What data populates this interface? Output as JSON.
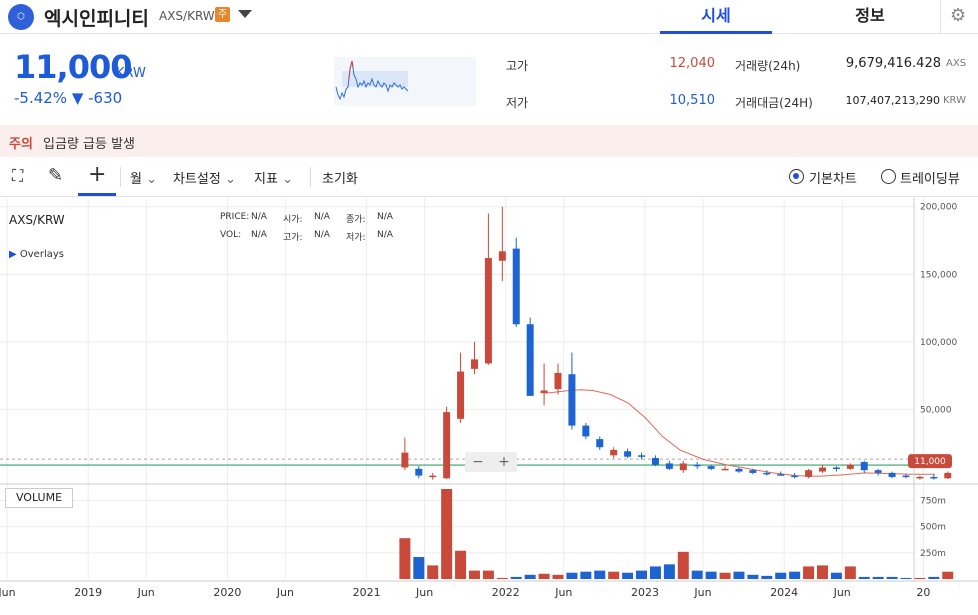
{
  "header": {
    "coin_name": "엑시인피니티",
    "pair": "AXS/KRW",
    "badge": "주",
    "tabs": [
      {
        "label": "시세",
        "active": true
      },
      {
        "label": "정보",
        "active": false
      }
    ]
  },
  "ticker": {
    "price": "11,000",
    "unit": "KRW",
    "change": "-5.42% ▼ -630",
    "high_label": "고가",
    "high": "12,040",
    "low_label": "저가",
    "low": "10,510",
    "volume_label": "거래량(24h)",
    "volume": "9,679,416.428",
    "volume_unit": "AXS",
    "amount_label": "거래대금(24H)",
    "amount": "107,407,213,290",
    "amount_unit": "KRW"
  },
  "warning": {
    "tag": "주의",
    "text": "입금량 급등 발생"
  },
  "toolbar": {
    "period": "월",
    "chart_settings": "차트설정",
    "indicators": "지표",
    "reset": "초기화",
    "basic_chart": "기본차트",
    "tradingview": "트레이딩뷰"
  },
  "colors": {
    "up": "#c94a3a",
    "down": "#1d63d1",
    "accent": "#1d4fd8",
    "ma": "#e06a5a"
  },
  "chart_data": {
    "type": "candlestick",
    "symbol": "AXS/KRW",
    "overlays_label": "Overlays",
    "ohlc_labels": {
      "price": "PRICE:",
      "vol": "VOL:",
      "open": "시가:",
      "high": "고가:",
      "close": "종가:",
      "low": "저가:",
      "na": "N/A"
    },
    "y_ticks": [
      "200,000",
      "150,000",
      "100,000",
      "50,000"
    ],
    "y_tick_values": [
      200000,
      150000,
      100000,
      50000
    ],
    "ylim": [
      -3000,
      202000
    ],
    "current_price_label": "11,000",
    "current_price": 11000,
    "x_ticks": [
      "Jun",
      "2019",
      "Jun",
      "2020",
      "Jun",
      "2021",
      "Jun",
      "2022",
      "Jun",
      "2023",
      "Jun",
      "2024",
      "Jun",
      "20"
    ],
    "x_tick_months": [
      0,
      7,
      12,
      19,
      24,
      31,
      36,
      43,
      48,
      55,
      60,
      67,
      72,
      79
    ],
    "volume_title": "VOLUME",
    "volume_ticks": [
      "750m",
      "500m",
      "250m"
    ],
    "volume_tick_values": [
      750,
      500,
      250
    ],
    "volume_max": 860,
    "candles": [
      {
        "m": 34.3,
        "o": 7000,
        "h": 29000,
        "l": 5000,
        "c": 18000
      },
      {
        "m": 35.5,
        "o": 6000,
        "h": 8000,
        "l": -1000,
        "c": 1000
      },
      {
        "m": 36.7,
        "o": 0,
        "h": 3000,
        "l": -2000,
        "c": 1000
      },
      {
        "m": 37.9,
        "o": -1000,
        "h": 52000,
        "l": -1500,
        "c": 48000
      },
      {
        "m": 39.1,
        "o": 43000,
        "h": 92000,
        "l": 40000,
        "c": 78000
      },
      {
        "m": 40.3,
        "o": 80000,
        "h": 100000,
        "l": 76000,
        "c": 87000
      },
      {
        "m": 41.5,
        "o": 84000,
        "h": 195000,
        "l": 83000,
        "c": 162000
      },
      {
        "m": 42.7,
        "o": 160000,
        "h": 200000,
        "l": 145000,
        "c": 167000
      },
      {
        "m": 43.9,
        "o": 169000,
        "h": 177000,
        "l": 111000,
        "c": 113000
      },
      {
        "m": 45.1,
        "o": 113000,
        "h": 118000,
        "l": 60000,
        "c": 60000
      },
      {
        "m": 46.3,
        "o": 62000,
        "h": 84000,
        "l": 53000,
        "c": 64000
      },
      {
        "m": 47.5,
        "o": 65000,
        "h": 84000,
        "l": 61000,
        "c": 77000
      },
      {
        "m": 48.7,
        "o": 76000,
        "h": 92000,
        "l": 35000,
        "c": 38000
      },
      {
        "m": 49.9,
        "o": 38000,
        "h": 40000,
        "l": 28000,
        "c": 30000
      },
      {
        "m": 51.1,
        "o": 28000,
        "h": 30000,
        "l": 20000,
        "c": 22000
      },
      {
        "m": 52.3,
        "o": 16000,
        "h": 22000,
        "l": 14000,
        "c": 20000
      },
      {
        "m": 53.5,
        "o": 19000,
        "h": 21000,
        "l": 14000,
        "c": 15000
      },
      {
        "m": 54.7,
        "o": 16000,
        "h": 18000,
        "l": 13000,
        "c": 15000
      },
      {
        "m": 55.9,
        "o": 14000,
        "h": 16000,
        "l": 8000,
        "c": 9000
      },
      {
        "m": 57.1,
        "o": 10000,
        "h": 12000,
        "l": 5000,
        "c": 6000
      },
      {
        "m": 58.3,
        "o": 5000,
        "h": 12000,
        "l": 3000,
        "c": 10000
      },
      {
        "m": 59.5,
        "o": 9000,
        "h": 11000,
        "l": 6000,
        "c": 8000
      },
      {
        "m": 60.7,
        "o": 8000,
        "h": 9000,
        "l": 5000,
        "c": 6000
      },
      {
        "m": 61.9,
        "o": 6000,
        "h": 8000,
        "l": 5000,
        "c": 6000
      },
      {
        "m": 63.1,
        "o": 6000,
        "h": 7000,
        "l": 3000,
        "c": 4000
      },
      {
        "m": 64.3,
        "o": 5000,
        "h": 6000,
        "l": 2000,
        "c": 3000
      },
      {
        "m": 65.5,
        "o": 3000,
        "h": 5000,
        "l": 1000,
        "c": 2000
      },
      {
        "m": 66.7,
        "o": 2000,
        "h": 4000,
        "l": 1000,
        "c": 1000
      },
      {
        "m": 67.9,
        "o": 1000,
        "h": 3000,
        "l": -1000,
        "c": 0
      },
      {
        "m": 69.1,
        "o": 0,
        "h": 6000,
        "l": -1000,
        "c": 5000
      },
      {
        "m": 70.3,
        "o": 4000,
        "h": 9000,
        "l": 3000,
        "c": 7000
      },
      {
        "m": 71.5,
        "o": 7000,
        "h": 8000,
        "l": 4000,
        "c": 6000
      },
      {
        "m": 72.7,
        "o": 6000,
        "h": 10000,
        "l": 5000,
        "c": 9000
      },
      {
        "m": 73.9,
        "o": 11000,
        "h": 12000,
        "l": 3000,
        "c": 5000
      },
      {
        "m": 75.1,
        "o": 5000,
        "h": 6000,
        "l": 1000,
        "c": 3000
      },
      {
        "m": 76.3,
        "o": 3000,
        "h": 4000,
        "l": -1000,
        "c": 0
      },
      {
        "m": 77.5,
        "o": 1000,
        "h": 2000,
        "l": -1000,
        "c": 0
      },
      {
        "m": 78.7,
        "o": -1000,
        "h": 1000,
        "l": -2000,
        "c": 0
      },
      {
        "m": 79.9,
        "o": 0,
        "h": 2000,
        "l": -2000,
        "c": -1000
      },
      {
        "m": 81.1,
        "o": -1000,
        "h": 4000,
        "l": -1500,
        "c": 3000
      }
    ],
    "ma": [
      [
        46.5,
        62000
      ],
      [
        48.5,
        64000
      ],
      [
        49.5,
        64500
      ],
      [
        50.5,
        64000
      ],
      [
        52,
        61000
      ],
      [
        53.5,
        55000
      ],
      [
        55,
        44000
      ],
      [
        56.5,
        30000
      ],
      [
        58,
        20000
      ],
      [
        60,
        13000
      ],
      [
        62,
        9000
      ],
      [
        64,
        6000
      ],
      [
        66,
        3000
      ],
      [
        68,
        1000
      ],
      [
        70,
        500
      ],
      [
        72,
        1500
      ],
      [
        74,
        3000
      ],
      [
        76,
        2500
      ],
      [
        78,
        2000
      ],
      [
        80,
        2000
      ]
    ],
    "volume": [
      {
        "m": 34.3,
        "v": 390
      },
      {
        "m": 35.5,
        "v": 210
      },
      {
        "m": 36.7,
        "v": 130
      },
      {
        "m": 37.9,
        "v": 860
      },
      {
        "m": 39.1,
        "v": 270
      },
      {
        "m": 40.3,
        "v": 80
      },
      {
        "m": 41.5,
        "v": 80
      },
      {
        "m": 42.7,
        "v": 10
      },
      {
        "m": 43.9,
        "v": 20
      },
      {
        "m": 45.1,
        "v": 40
      },
      {
        "m": 46.3,
        "v": 50
      },
      {
        "m": 47.5,
        "v": 40
      },
      {
        "m": 48.7,
        "v": 60
      },
      {
        "m": 49.9,
        "v": 70
      },
      {
        "m": 51.1,
        "v": 80
      },
      {
        "m": 52.3,
        "v": 70
      },
      {
        "m": 53.5,
        "v": 60
      },
      {
        "m": 54.7,
        "v": 80
      },
      {
        "m": 55.9,
        "v": 120
      },
      {
        "m": 57.1,
        "v": 140
      },
      {
        "m": 58.3,
        "v": 260
      },
      {
        "m": 59.5,
        "v": 80
      },
      {
        "m": 60.7,
        "v": 70
      },
      {
        "m": 61.9,
        "v": 60
      },
      {
        "m": 63.1,
        "v": 70
      },
      {
        "m": 64.3,
        "v": 40
      },
      {
        "m": 65.5,
        "v": 30
      },
      {
        "m": 66.7,
        "v": 60
      },
      {
        "m": 67.9,
        "v": 70
      },
      {
        "m": 69.1,
        "v": 120
      },
      {
        "m": 70.3,
        "v": 130
      },
      {
        "m": 71.5,
        "v": 60
      },
      {
        "m": 72.7,
        "v": 120
      },
      {
        "m": 73.9,
        "v": 20
      },
      {
        "m": 75.1,
        "v": 20
      },
      {
        "m": 76.3,
        "v": 20
      },
      {
        "m": 77.5,
        "v": 10
      },
      {
        "m": 78.7,
        "v": 10
      },
      {
        "m": 79.9,
        "v": 20
      },
      {
        "m": 81.1,
        "v": 70
      }
    ]
  }
}
